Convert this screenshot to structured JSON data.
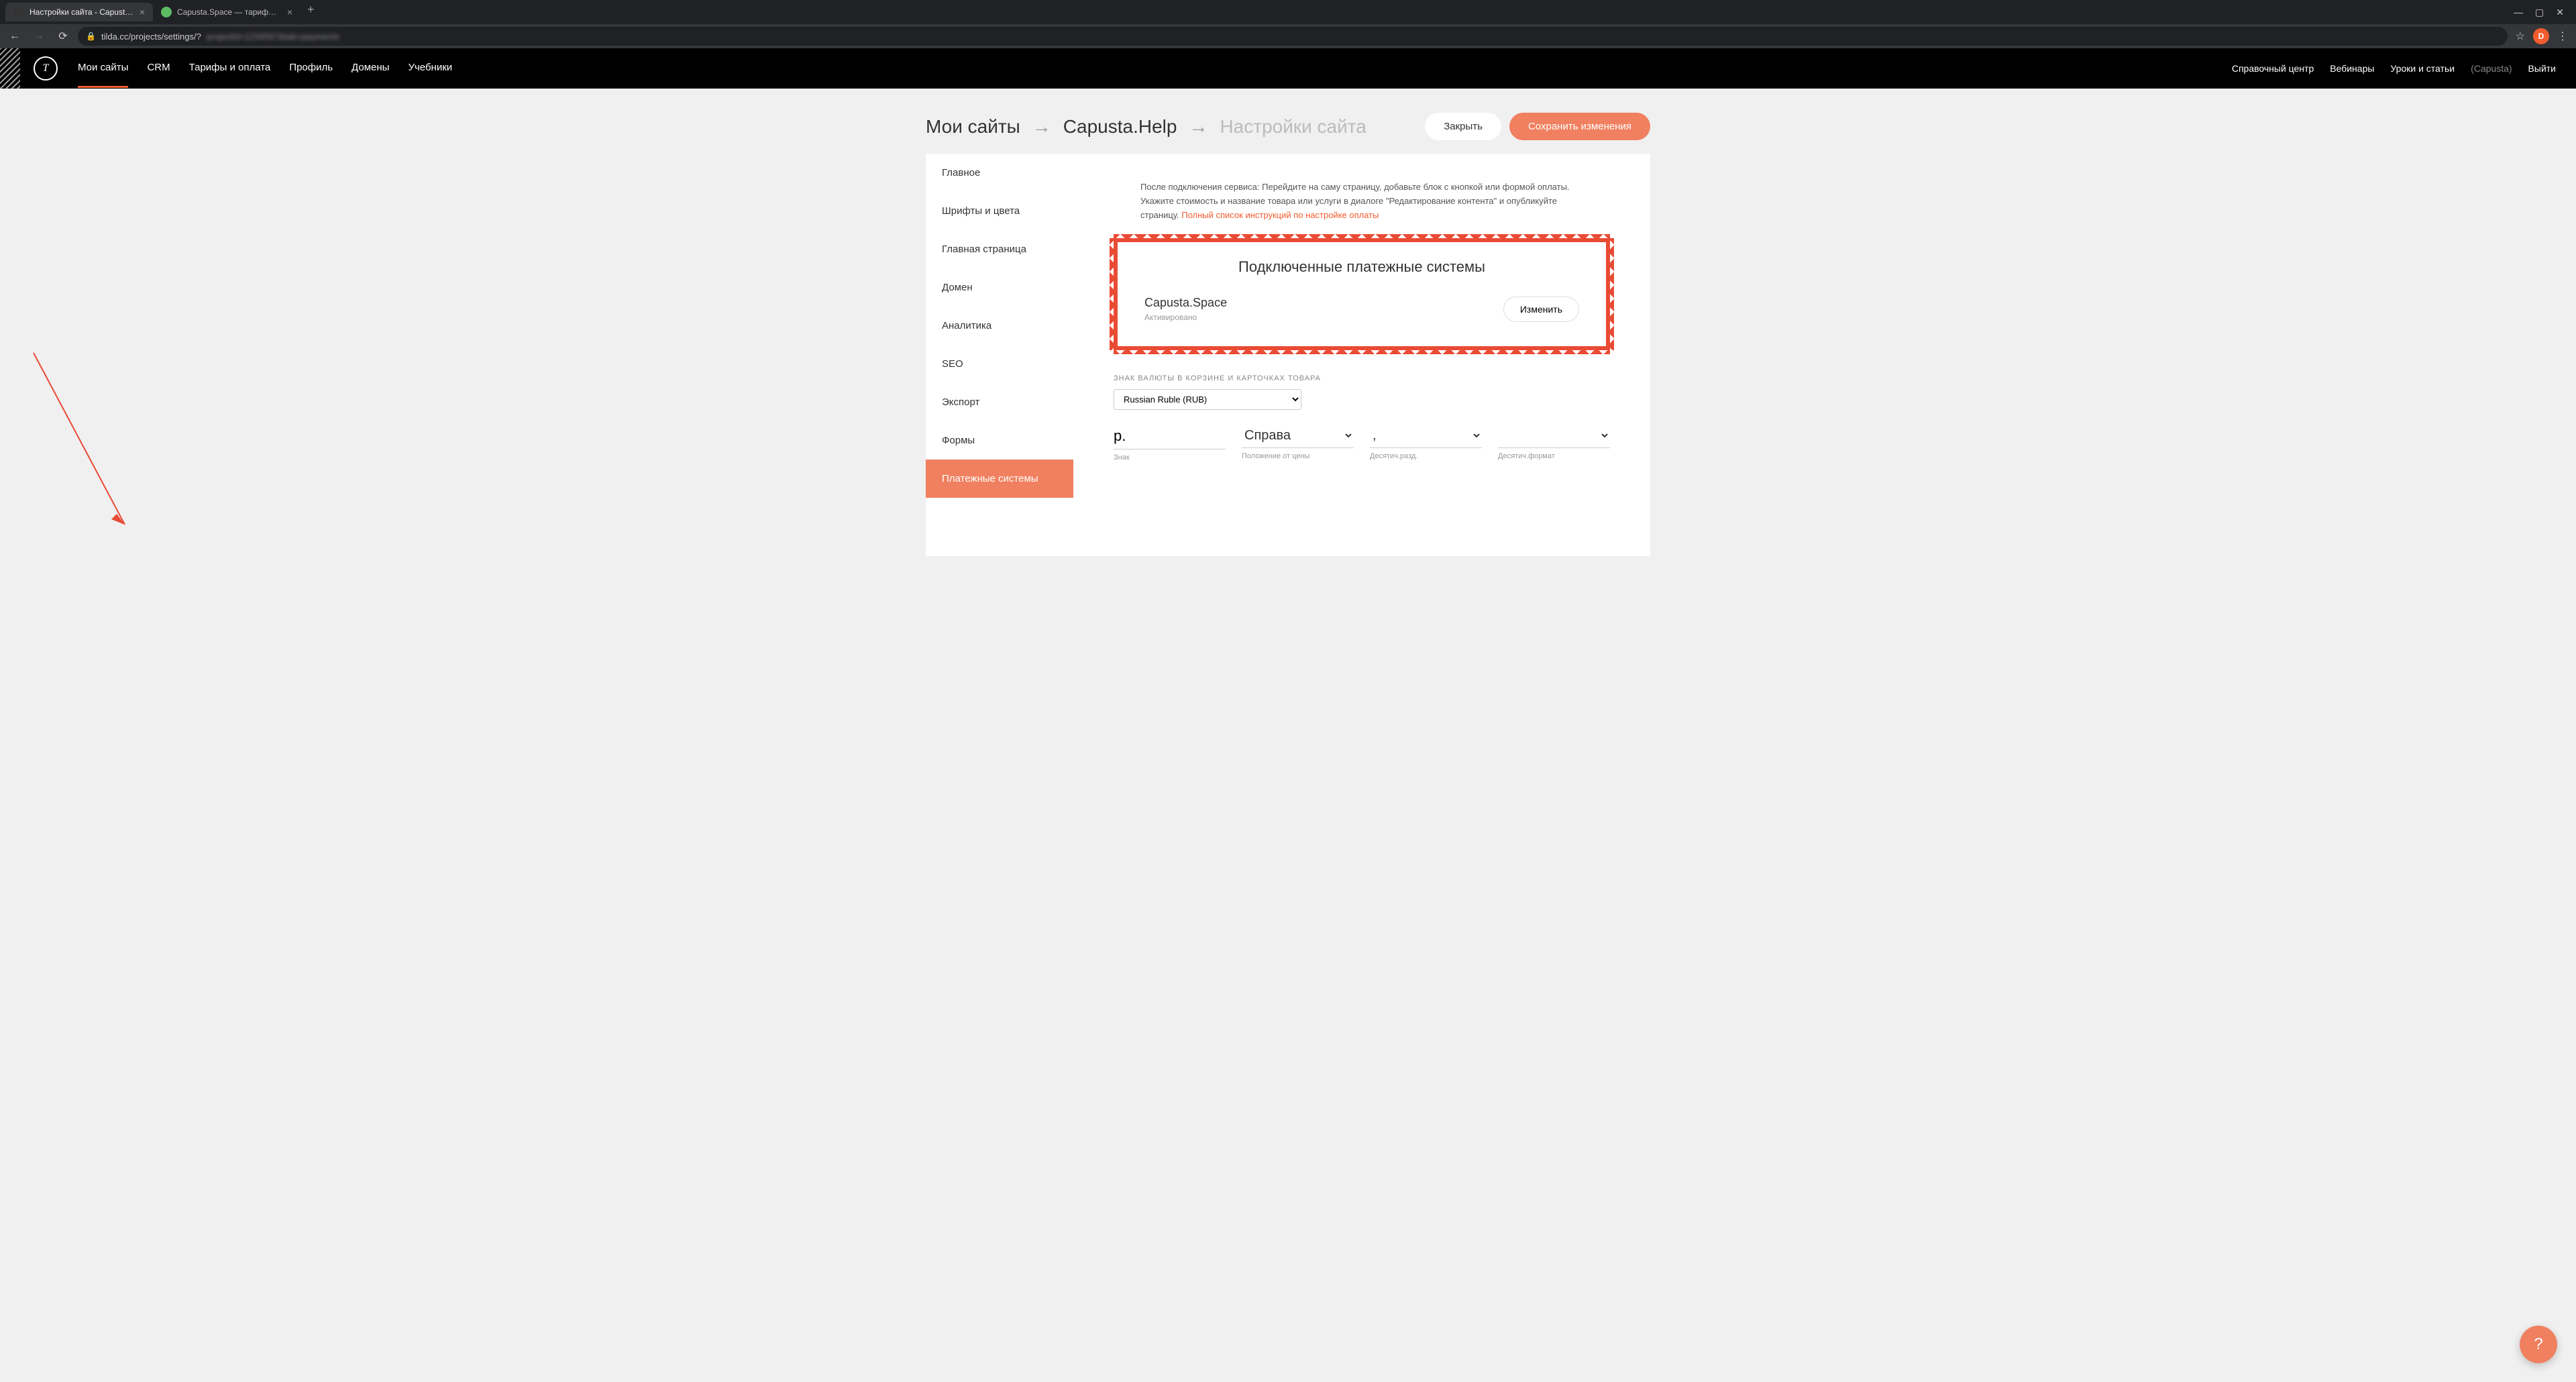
{
  "browser": {
    "tabs": [
      {
        "title": "Настройки сайта - Capusta.Help",
        "active": true,
        "favicon_bg": "#333"
      },
      {
        "title": "Capusta.Space — тарифы и усло",
        "active": false,
        "favicon_bg": "#5DBB63"
      }
    ],
    "url_visible": "tilda.cc/projects/settings/?",
    "profile_letter": "D"
  },
  "tilda_nav": {
    "left": [
      "Мои сайты",
      "CRM",
      "Тарифы и оплата",
      "Профиль",
      "Домены",
      "Учебники"
    ],
    "active_index": 0,
    "right": [
      "Справочный центр",
      "Вебинары",
      "Уроки и статьи"
    ],
    "user": "(Capusta)",
    "logout": "Выйти",
    "logo_letter": "T"
  },
  "breadcrumb": {
    "root": "Мои сайты",
    "project": "Capusta.Help",
    "current": "Настройки сайта"
  },
  "header_buttons": {
    "close": "Закрыть",
    "save": "Сохранить изменения"
  },
  "sidebar": {
    "items": [
      "Главное",
      "Шрифты и цвета",
      "Главная страница",
      "Домен",
      "Аналитика",
      "SEO",
      "Экспорт",
      "Формы",
      "Платежные системы"
    ],
    "active_index": 8
  },
  "main": {
    "intro": "После подключения сервиса: Перейдите на саму страницу, добавьте блок с кнопкой или формой оплаты. Укажите стоимость и название товара или услуги в диалоге \"Редактирование контента\" и опубликуйте страницу. ",
    "intro_link": "Полный список инструкций по настройке оплаты",
    "connected_title": "Подключенные платежные системы",
    "connected_system": {
      "name": "Capusta.Space",
      "status": "Активировано",
      "edit_label": "Изменить"
    },
    "currency_section_label": "ЗНАК ВАЛЮТЫ В КОРЗИНЕ И КАРТОЧКАХ ТОВАРА",
    "currency_select_value": "Russian Ruble (RUB)",
    "currency_cols": [
      {
        "value": "р.",
        "sub": "Знак",
        "type": "input"
      },
      {
        "value": "Справа",
        "sub": "Положение от цены",
        "type": "select"
      },
      {
        "value": ",",
        "sub": "Десятич.разд.",
        "type": "select"
      },
      {
        "value": "",
        "sub": "Десятич.формат",
        "type": "select"
      }
    ]
  },
  "help_fab": "?"
}
